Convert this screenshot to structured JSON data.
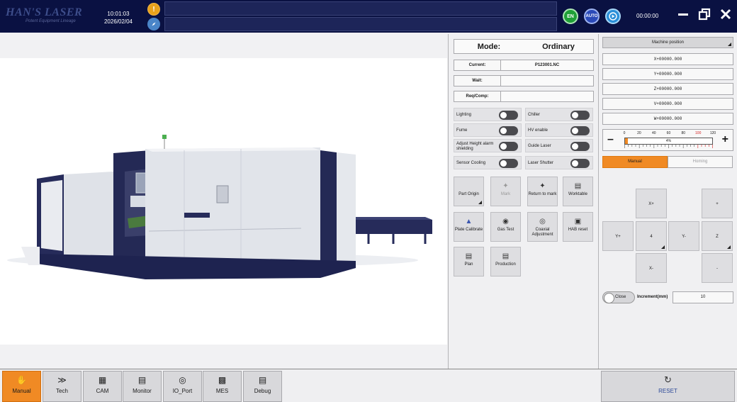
{
  "header": {
    "logo": "HAN'S LASER",
    "logo_sub": "Potent Equipment Lineage",
    "time": "10:01:03",
    "date": "2026/02/04",
    "lang_button": "EN",
    "auto_button": "AUTO",
    "timer": "00:00:00"
  },
  "status": {
    "mode_label": "Mode:",
    "mode_value": "Ordinary",
    "current_label": "Current:",
    "current_value": "P123001.NC",
    "wait_label": "Wait:",
    "wait_value": "",
    "reqcomp_label": "Req/Comp:",
    "reqcomp_value": ""
  },
  "toggles": [
    {
      "label": "Lighting",
      "on": false
    },
    {
      "label": "Chiller",
      "on": false
    },
    {
      "label": "Fume",
      "on": false
    },
    {
      "label": "HV enable",
      "on": false
    },
    {
      "label": "Adjust Height alarm shielding",
      "on": false
    },
    {
      "label": "Guide Laser",
      "on": false
    },
    {
      "label": "Sensor Cooling",
      "on": false
    },
    {
      "label": "Laser Shutter",
      "on": false
    }
  ],
  "functions": [
    {
      "label": "Part Origin",
      "icon": "part-origin-icon"
    },
    {
      "label": "Mark",
      "icon": "mark-icon"
    },
    {
      "label": "Return to mark",
      "icon": "return-to-mark-icon"
    },
    {
      "label": "Worktable",
      "icon": "worktable-icon"
    },
    {
      "label": "Plate Calibrate",
      "icon": "plate-calibrate-icon"
    },
    {
      "label": "Gas Test",
      "icon": "gas-test-icon"
    },
    {
      "label": "Coaxial Adjustment",
      "icon": "coaxial-icon"
    },
    {
      "label": "HAB reset",
      "icon": "hab-reset-icon"
    },
    {
      "label": "Plan",
      "icon": "plan-icon"
    },
    {
      "label": "Production",
      "icon": "production-icon"
    }
  ],
  "position": {
    "title": "Machine position",
    "axes": [
      "X+00000.000",
      "Y+00000.000",
      "Z+00000.000",
      "V+00000.000",
      "W+00000.000"
    ]
  },
  "override": {
    "ticks": [
      "0",
      "20",
      "40",
      "60",
      "80",
      "100",
      "120"
    ],
    "value_label": "4%",
    "value": 4
  },
  "jog": {
    "tab_manual": "Manual",
    "tab_homing": "Homing",
    "x_plus": "X+",
    "x_minus": "X-",
    "y_plus": "Y+",
    "y_minus": "Y-",
    "center": "4",
    "plus": "+",
    "minus": "-",
    "z": "Z"
  },
  "increment": {
    "switch_label": "Close",
    "label": "Increment(mm)",
    "value": "10"
  },
  "nav": [
    {
      "label": "Manual",
      "icon": "hand-icon",
      "active": true
    },
    {
      "label": "Tech",
      "icon": "tech-icon"
    },
    {
      "label": "CAM",
      "icon": "cam-icon"
    },
    {
      "label": "Monitor",
      "icon": "monitor-icon"
    },
    {
      "label": "IO_Port",
      "icon": "io-port-icon"
    },
    {
      "label": "MES",
      "icon": "mes-icon"
    },
    {
      "label": "Debug",
      "icon": "debug-icon"
    }
  ],
  "reset_label": "RESET",
  "colors": {
    "topbar": "#0a1142",
    "accent": "#f08a24",
    "machine_body": "#e3e6ec",
    "machine_dark": "#1f2450"
  }
}
